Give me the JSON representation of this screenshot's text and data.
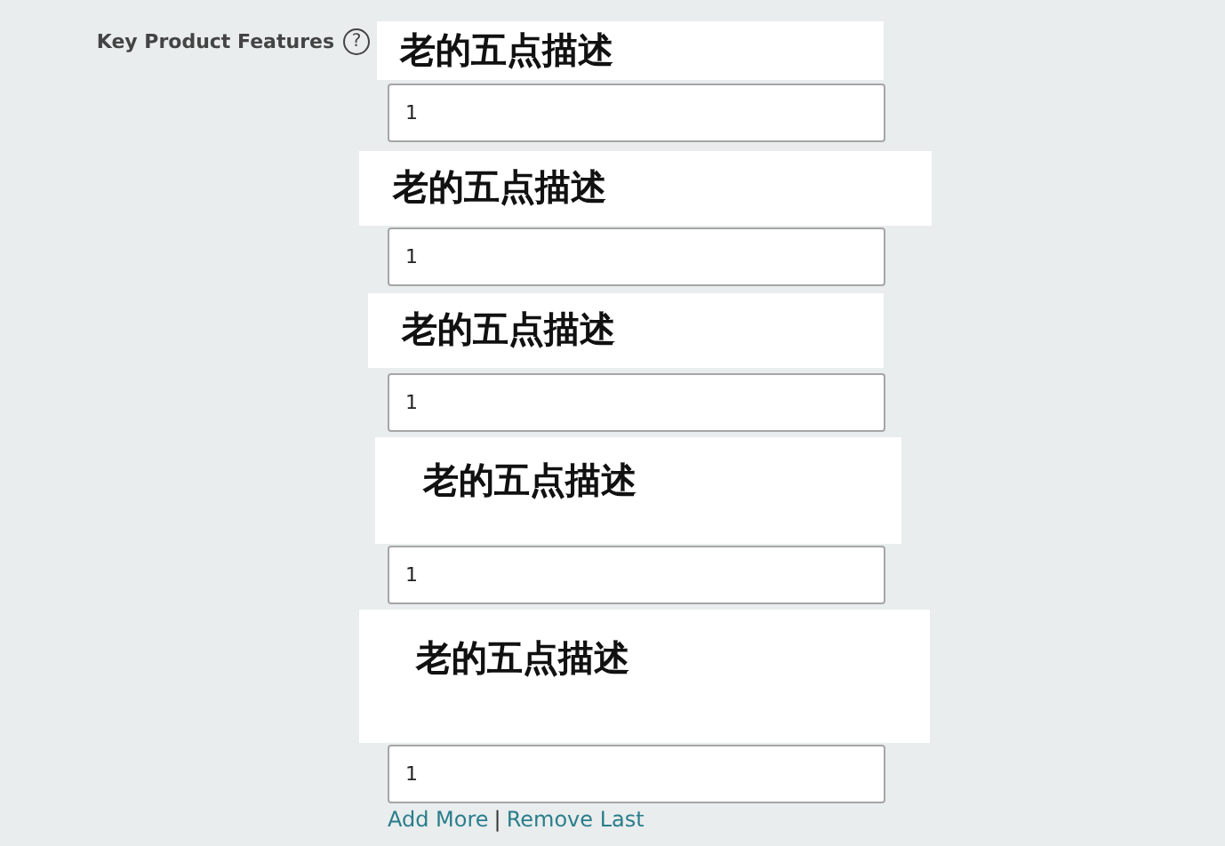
{
  "field": {
    "label": "Key Product Features",
    "help": "?"
  },
  "features": [
    {
      "note": "老的五点描述",
      "value": "1"
    },
    {
      "note": "老的五点描述",
      "value": "1"
    },
    {
      "note": "老的五点描述",
      "value": "1"
    },
    {
      "note": "老的五点描述",
      "value": "1"
    },
    {
      "note": "老的五点描述",
      "value": "1"
    }
  ],
  "actions": {
    "add": "Add More",
    "separator": "|",
    "remove": "Remove Last"
  }
}
